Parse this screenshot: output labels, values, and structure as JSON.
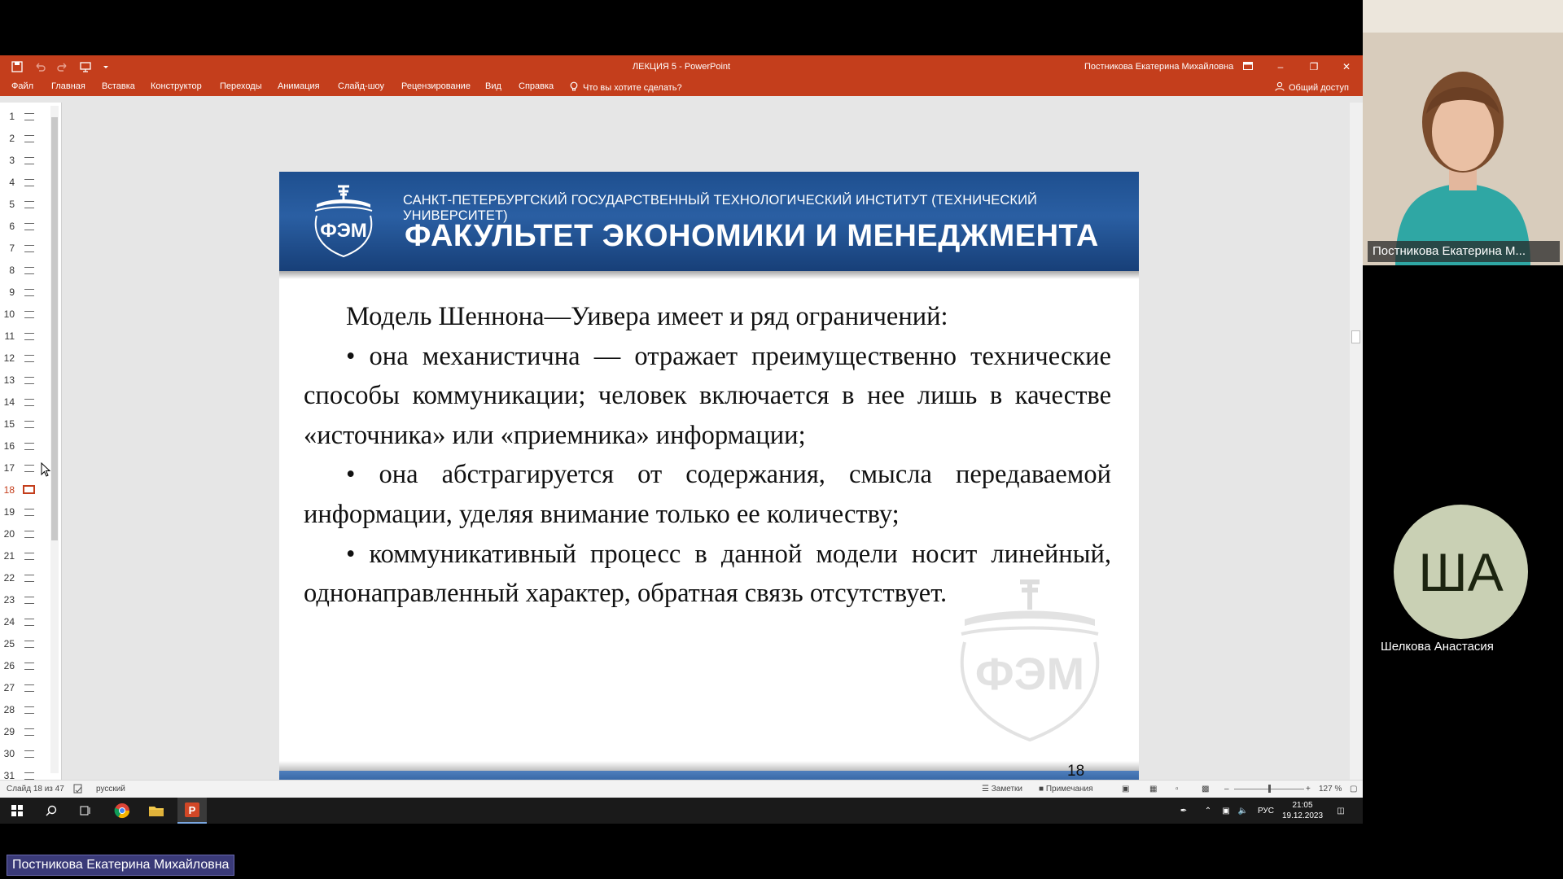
{
  "app": {
    "title": "ЛЕКЦИЯ 5  -  PowerPoint",
    "user": "Постникова Екатерина Михайловна"
  },
  "ribbon": {
    "tabs": [
      "Файл",
      "Главная",
      "Вставка",
      "Конструктор",
      "Переходы",
      "Анимация",
      "Слайд-шоу",
      "Рецензирование",
      "Вид",
      "Справка"
    ],
    "tell_me": "Что вы хотите сделать?",
    "share": "Общий доступ"
  },
  "outline": {
    "numbers": [
      "1",
      "2",
      "3",
      "4",
      "5",
      "6",
      "7",
      "8",
      "9",
      "10",
      "11",
      "12",
      "13",
      "14",
      "15",
      "16",
      "17",
      "18",
      "19",
      "20",
      "21",
      "22",
      "23",
      "24",
      "25",
      "26",
      "27",
      "28",
      "29",
      "30",
      "31"
    ],
    "active": "18"
  },
  "slide": {
    "institute": "САНКТ-ПЕТЕРБУРГСКИЙ ГОСУДАРСТВЕННЫЙ ТЕХНОЛОГИЧЕСКИЙ ИНСТИТУТ (ТЕХНИЧЕСКИЙ УНИВЕРСИТЕТ)",
    "faculty": "ФАКУЛЬТЕТ ЭКОНОМИКИ И МЕНЕДЖМЕНТА",
    "logo_text": "ФЭМ",
    "logo_ring": "Факультет Экономики и Менеджмента",
    "paragraphs": [
      "Модель Шеннона—Уивера имеет и ряд ограничений:",
      "•  она механистична — отражает преимущественно технические способы коммуникации; человек включается в нее лишь в качестве «источника» или «приемника» информации;",
      "• она абстрагируется от содержания, смысла передаваемой информации, уделяя внимание только ее количеству;",
      "•  коммуникативный процесс в данной модели носит линейный, однонаправленный характер, обратная связь отсутствует."
    ],
    "number": "18"
  },
  "statusbar": {
    "slide_info": "Слайд 18 из 47",
    "language": "русский",
    "notes": "Заметки",
    "comments": "Примечания",
    "zoom": "127 %"
  },
  "taskbar": {
    "lang": "РУС",
    "time": "21:05",
    "date": "19.12.2023"
  },
  "participants": {
    "presenter_tile": "Постникова Екатерина М...",
    "other_initials": "ША",
    "other_name": "Шелкова Анастасия",
    "presenter_label": "Постникова Екатерина Михайловна"
  },
  "colors": {
    "ppt_accent": "#c43e1c",
    "slide_header": "#1e4f8f",
    "avatar_bg": "#c9d0b4"
  }
}
